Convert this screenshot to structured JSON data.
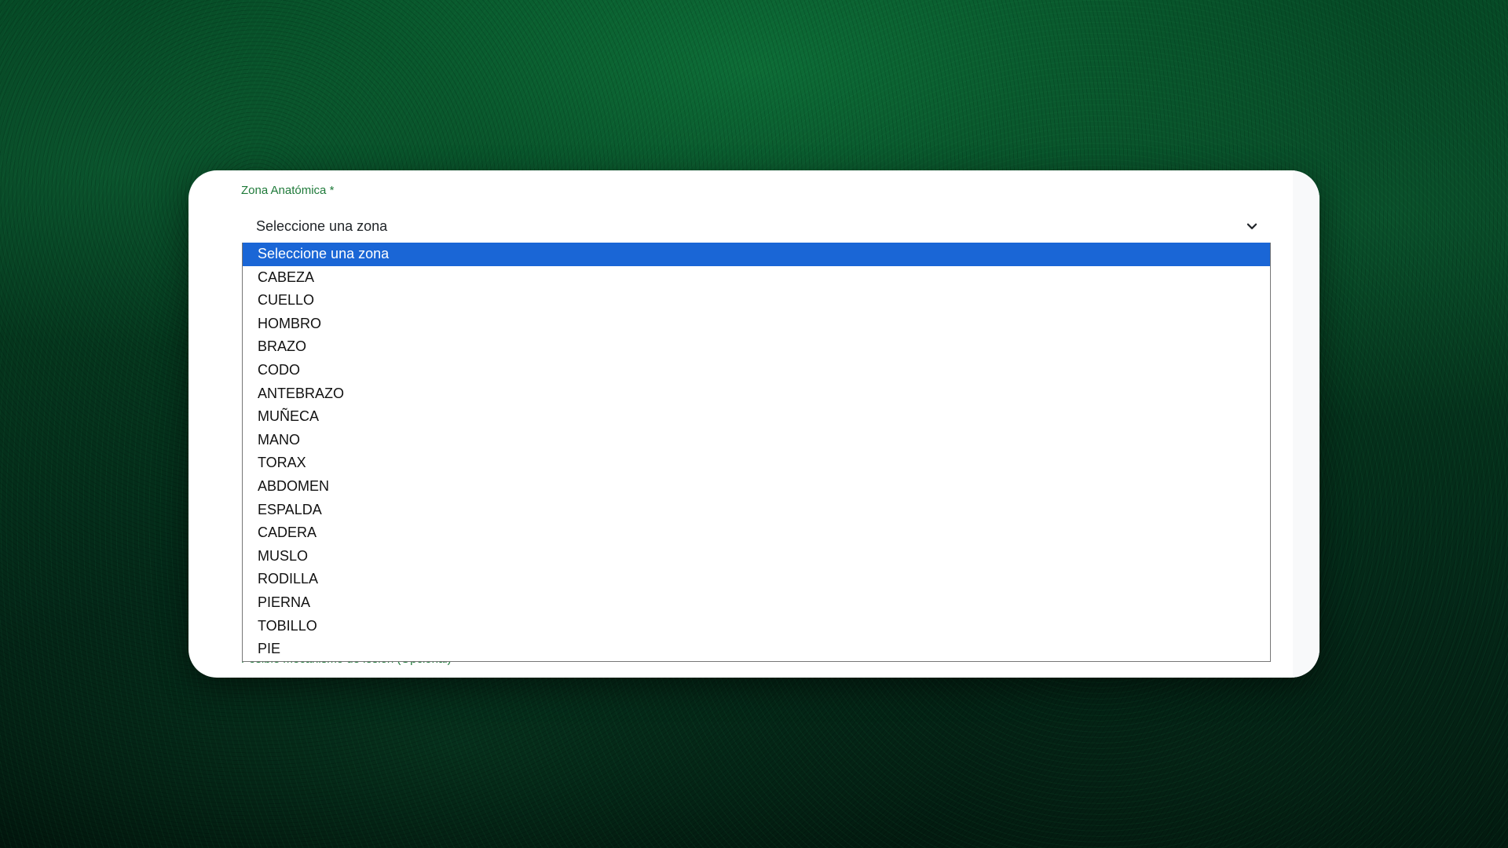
{
  "form": {
    "field_label": "Zona Anatómica *",
    "select_value": "Seleccione una zona",
    "next_field_label": "Posible mecanismo de lesión (Opcional)"
  },
  "dropdown": {
    "selected_index": 0,
    "options": [
      "Seleccione una zona",
      "CABEZA",
      "CUELLO",
      "HOMBRO",
      "BRAZO",
      "CODO",
      "ANTEBRAZO",
      "MUÑECA",
      "MANO",
      "TORAX",
      "ABDOMEN",
      "ESPALDA",
      "CADERA",
      "MUSLO",
      "RODILLA",
      "PIERNA",
      "TOBILLO",
      "PIE"
    ]
  },
  "icons": {
    "select_arrow": "chevron-down-icon"
  },
  "colors": {
    "label_green": "#1f7a3a",
    "highlight_blue": "#1a66d6"
  }
}
